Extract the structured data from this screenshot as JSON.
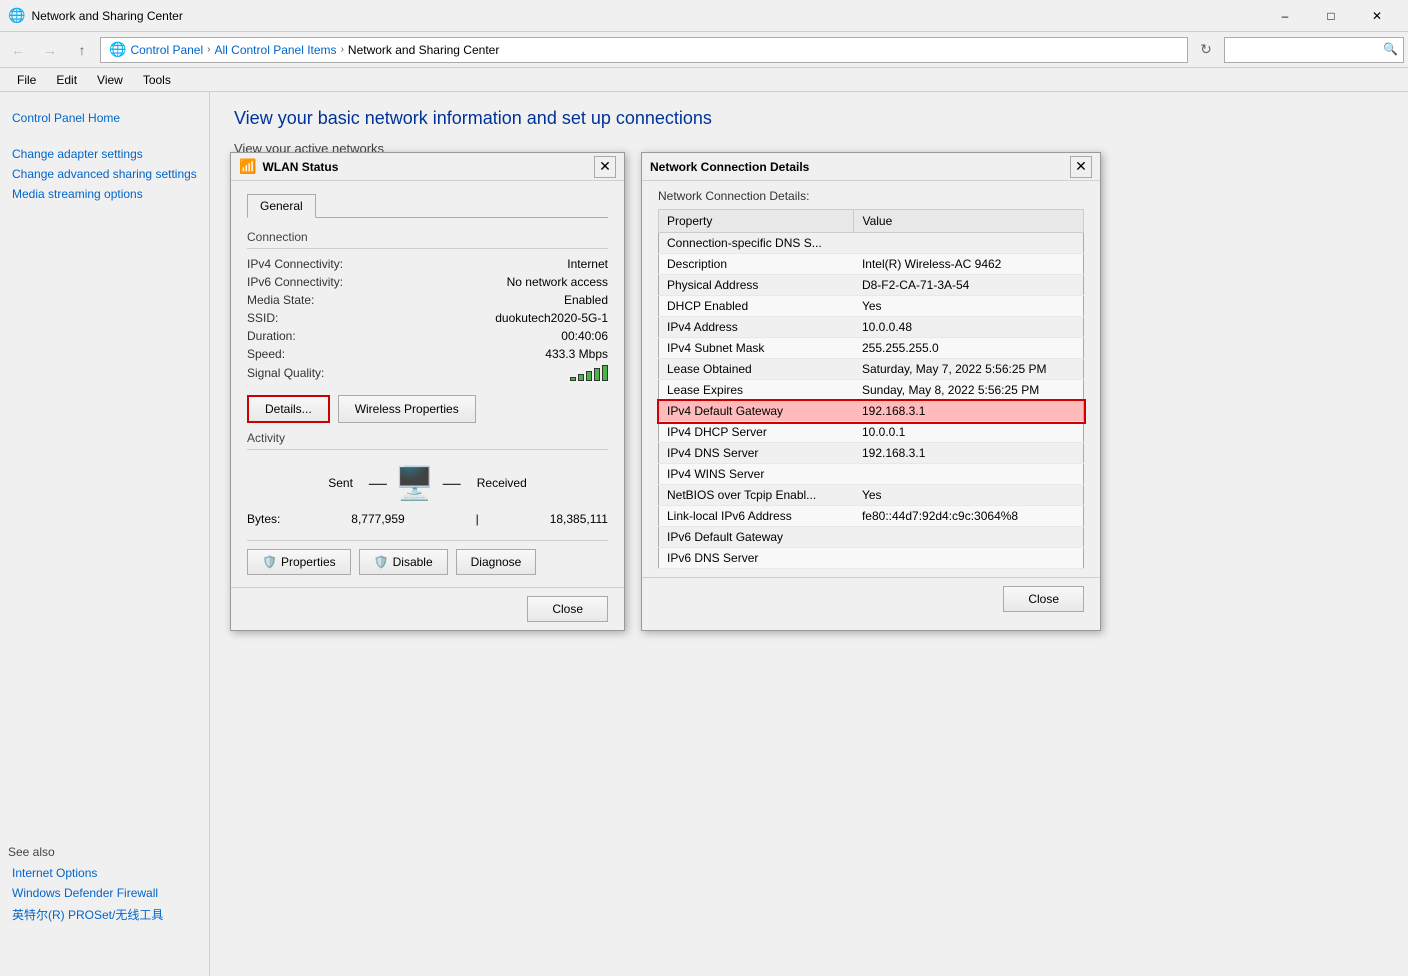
{
  "titleBar": {
    "title": "Network and Sharing Center",
    "icon": "🌐",
    "minimizeLabel": "–",
    "maximizeLabel": "□",
    "closeLabel": "✕"
  },
  "addressBar": {
    "backLabel": "←",
    "forwardLabel": "→",
    "upLabel": "↑",
    "pathIcon": "🌐",
    "path": [
      {
        "label": "Control Panel"
      },
      {
        "label": "All Control Panel Items"
      },
      {
        "label": "Network and Sharing Center"
      }
    ],
    "refreshLabel": "↻",
    "searchPlaceholder": ""
  },
  "menuBar": {
    "items": [
      "File",
      "Edit",
      "View",
      "Tools"
    ]
  },
  "sidebar": {
    "links": [
      {
        "label": "Control Panel Home"
      },
      {
        "label": "Change adapter settings"
      },
      {
        "label": "Change advanced sharing settings"
      },
      {
        "label": "Media streaming options"
      }
    ],
    "seeAlso": {
      "title": "See also",
      "links": [
        {
          "label": "Internet Options"
        },
        {
          "label": "Windows Defender Firewall"
        },
        {
          "label": "英特尔(R) PROSet/无线工具"
        }
      ]
    }
  },
  "content": {
    "pageTitle": "View your basic network information and set up connections",
    "activeNetworksTitle": "View your active networks"
  },
  "wlanDialog": {
    "title": "WLAN Status",
    "tabs": [
      {
        "label": "General"
      }
    ],
    "connection": {
      "sectionTitle": "Connection",
      "rows": [
        {
          "label": "IPv4 Connectivity:",
          "value": "Internet"
        },
        {
          "label": "IPv6 Connectivity:",
          "value": "No network access"
        },
        {
          "label": "Media State:",
          "value": "Enabled"
        },
        {
          "label": "SSID:",
          "value": "duokutech2020-5G-1"
        },
        {
          "label": "Duration:",
          "value": "00:40:06"
        },
        {
          "label": "Speed:",
          "value": "433.3 Mbps"
        },
        {
          "label": "Signal Quality:",
          "value": ""
        }
      ]
    },
    "buttons": {
      "details": "Details...",
      "wirelessProperties": "Wireless Properties"
    },
    "activity": {
      "sectionTitle": "Activity",
      "sent": "Sent",
      "received": "Received",
      "bytes": {
        "label": "Bytes:",
        "sentValue": "8,777,959",
        "receivedValue": "18,385,111"
      }
    },
    "bottomButtons": {
      "properties": "Properties",
      "disable": "Disable",
      "diagnose": "Diagnose"
    },
    "closeLabel": "Close"
  },
  "detailsDialog": {
    "title": "Network Connection Details",
    "sectionTitle": "Network Connection Details:",
    "columns": {
      "property": "Property",
      "value": "Value"
    },
    "rows": [
      {
        "property": "Connection-specific DNS S...",
        "value": "",
        "highlighted": false
      },
      {
        "property": "Description",
        "value": "Intel(R) Wireless-AC 9462",
        "highlighted": false
      },
      {
        "property": "Physical Address",
        "value": "D8-F2-CA-71-3A-54",
        "highlighted": false
      },
      {
        "property": "DHCP Enabled",
        "value": "Yes",
        "highlighted": false
      },
      {
        "property": "IPv4 Address",
        "value": "10.0.0.48",
        "highlighted": false
      },
      {
        "property": "IPv4 Subnet Mask",
        "value": "255.255.255.0",
        "highlighted": false
      },
      {
        "property": "Lease Obtained",
        "value": "Saturday, May 7, 2022 5:56:25 PM",
        "highlighted": false
      },
      {
        "property": "Lease Expires",
        "value": "Sunday, May 8, 2022 5:56:25 PM",
        "highlighted": false
      },
      {
        "property": "IPv4 Default Gateway",
        "value": "192.168.3.1",
        "highlighted": true
      },
      {
        "property": "IPv4 DHCP Server",
        "value": "10.0.0.1",
        "highlighted": false
      },
      {
        "property": "IPv4 DNS Server",
        "value": "192.168.3.1",
        "highlighted": false
      },
      {
        "property": "IPv4 WINS Server",
        "value": "",
        "highlighted": false
      },
      {
        "property": "NetBIOS over Tcpip Enabl...",
        "value": "Yes",
        "highlighted": false
      },
      {
        "property": "Link-local IPv6 Address",
        "value": "fe80::44d7:92d4:c9c:3064%8",
        "highlighted": false
      },
      {
        "property": "IPv6 Default Gateway",
        "value": "",
        "highlighted": false
      },
      {
        "property": "IPv6 DNS Server",
        "value": "",
        "highlighted": false
      }
    ],
    "closeLabel": "Close"
  }
}
